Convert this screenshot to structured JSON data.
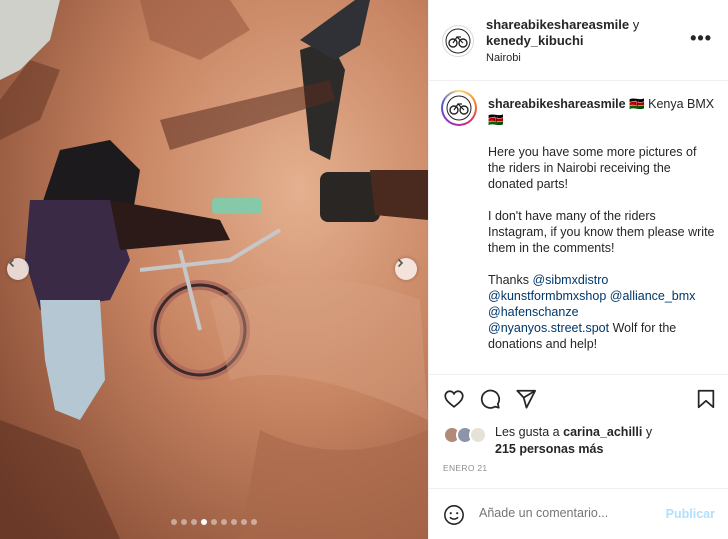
{
  "post": {
    "author": "shareabikeshareasmile",
    "connector": "y",
    "coauthor": "kenedy_kibuchi",
    "location": "Nairobi",
    "more_label": "•••"
  },
  "caption": {
    "author": "shareabikeshareasmile",
    "flag_1": "🇰🇪",
    "headline": "Kenya BMX",
    "flag_2": "🇰🇪",
    "paragraph_1": "Here you have some more pictures of the riders in Nairobi receiving the donated parts!",
    "paragraph_2": "I don't have many of the riders Instagram, if you know them please write them in the comments!",
    "thanks": "Thanks",
    "mention_1": "@sibmxdistro",
    "mention_2": "@kunstformbmxshop",
    "mention_3": "@alliance_bmx",
    "mention_4": "@hafenschanze",
    "mention_5": "@nyanyos.street.spot",
    "closing": "Wolf for the donations and help!"
  },
  "actions": {
    "like_icon": "heart-icon",
    "comment_icon": "comment-icon",
    "share_icon": "paper-plane-icon",
    "save_icon": "bookmark-icon"
  },
  "likes": {
    "prefix": "Les gusta a",
    "user": "carina_achilli",
    "connector": "y",
    "count_text": "215 personas más"
  },
  "date": "ENERO 21",
  "comment_box": {
    "placeholder": "Añade un comentario...",
    "publish_label": "Publicar",
    "emoji_icon": "smiley-icon"
  },
  "carousel": {
    "slide_count": 9,
    "active_slide": 4,
    "prev_icon": "chevron-left-icon",
    "next_icon": "chevron-right-icon"
  },
  "colors": {
    "link": "#00376b",
    "publish_disabled": "#b2dffc",
    "muted": "#8e8e8e"
  }
}
